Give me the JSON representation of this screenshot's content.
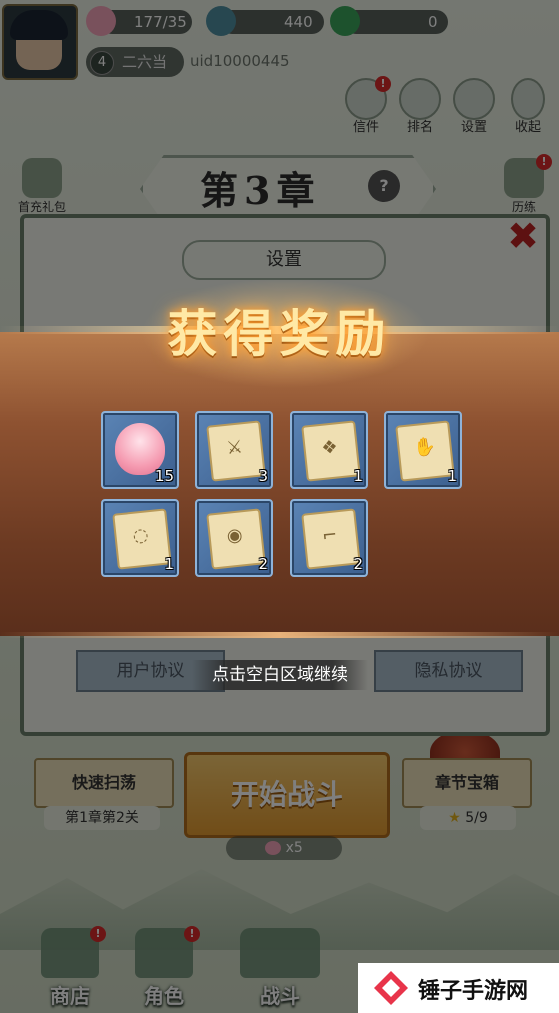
{
  "resources": [
    {
      "value": "177/35",
      "icon": "peach-icon",
      "color": "#f2a2b8"
    },
    {
      "value": "440",
      "icon": "coin-icon",
      "color": "#4f8fa0"
    },
    {
      "value": "0",
      "icon": "jade-icon",
      "color": "#3aa55a"
    }
  ],
  "player": {
    "level": "4",
    "name": "二六当",
    "uid": "uid10000445"
  },
  "top_buttons": [
    {
      "label": "信件",
      "icon": "mail-icon",
      "badge": "!"
    },
    {
      "label": "排名",
      "icon": "ranking-icon"
    },
    {
      "label": "设置",
      "icon": "settings-icon"
    },
    {
      "label": "收起",
      "icon": "collapse-icon"
    }
  ],
  "chapter": {
    "title": "第3章",
    "help": "?"
  },
  "side": {
    "gift_label": "首充礼包",
    "history_label": "历练",
    "history_badge": "!"
  },
  "settings": {
    "title": "设置",
    "user_agreement": "用户协议",
    "privacy_agreement": "隐私协议"
  },
  "reward": {
    "title": "获得奖励",
    "continue_hint": "点击空白区域继续",
    "items": [
      {
        "type": "peach",
        "count": "15",
        "icon": "peach-icon"
      },
      {
        "type": "scroll",
        "count": "3",
        "icon": "weapon-scroll-icon",
        "mark": "⚔"
      },
      {
        "type": "scroll",
        "count": "1",
        "icon": "armor-scroll-icon",
        "mark": "❖"
      },
      {
        "type": "scroll",
        "count": "1",
        "icon": "bracer-scroll-icon",
        "mark": "✋"
      },
      {
        "type": "scroll",
        "count": "1",
        "icon": "necklace-scroll-icon",
        "mark": "◌"
      },
      {
        "type": "scroll",
        "count": "2",
        "icon": "ring-scroll-icon",
        "mark": "◉"
      },
      {
        "type": "scroll",
        "count": "2",
        "icon": "boots-scroll-icon",
        "mark": "⌐"
      }
    ]
  },
  "battle": {
    "sweep_label": "快速扫荡",
    "sweep_stage": "第1章第2关",
    "start_label": "开始战斗",
    "cost": "x5",
    "chest_label": "章节宝箱",
    "chest_progress": "5/9",
    "star": "★"
  },
  "nav": [
    {
      "label": "商店",
      "icon": "shop-icon",
      "badge": "!"
    },
    {
      "label": "角色",
      "icon": "character-icon",
      "badge": "!"
    },
    {
      "label": "战斗",
      "icon": "battle-icon"
    }
  ],
  "watermark": {
    "text": "锤子手游网"
  },
  "colors": {
    "reward_band": "#7a4328",
    "item_bg": "#4a6fa0",
    "start_button": "#eeae48",
    "badge": "#d92b2b"
  }
}
